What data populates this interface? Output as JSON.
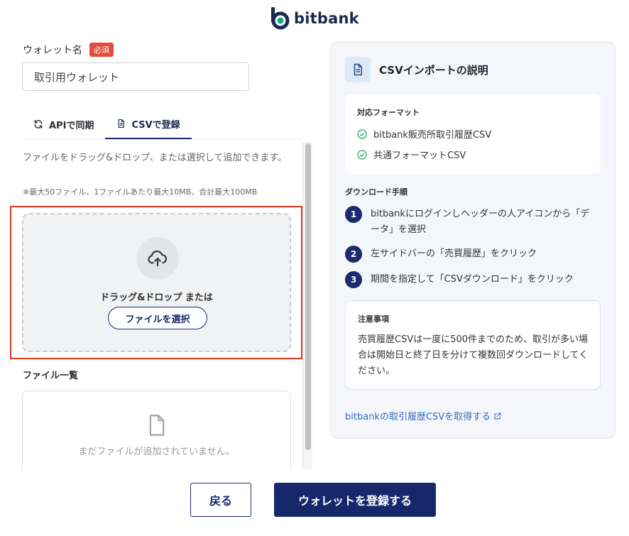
{
  "brand": {
    "name": "bitbank",
    "primary_color": "#1a2a6c",
    "accent_color": "#e14d3f",
    "logo_icon": "bitbank-logo-icon"
  },
  "form": {
    "wallet_name_label": "ウォレット名",
    "required_badge": "必須",
    "wallet_name_value": "取引用ウォレット"
  },
  "tabs": [
    {
      "label": "APIで同期",
      "icon": "sync-icon",
      "active": false
    },
    {
      "label": "CSVで登録",
      "icon": "document-icon",
      "active": true
    }
  ],
  "upload": {
    "description": "ファイルをドラッグ&ドロップ、または選択して追加できます。",
    "note": "※最大50ファイル、1ファイルあたり最大10MB、合計最大100MB",
    "drop_text": "ドラッグ&ドロップ または",
    "choose_label": "ファイルを選択",
    "icon": "upload-cloud-icon"
  },
  "file_list": {
    "title": "ファイル一覧",
    "empty_text": "まだファイルが追加されていません。",
    "icon": "file-icon"
  },
  "panel": {
    "title": "CSVインポートの説明",
    "formats_title": "対応フォーマット",
    "formats": [
      "bitbank販売所取引履歴CSV",
      "共通フォーマットCSV"
    ],
    "steps_title": "ダウンロード手順",
    "steps": [
      {
        "num": "1",
        "text": "bitbankにログインしヘッダーの人アイコンから「データ」を選択"
      },
      {
        "num": "2",
        "text": "左サイドバーの「売買履歴」をクリック"
      },
      {
        "num": "3",
        "text": "期間を指定して「CSVダウンロード」をクリック"
      }
    ],
    "caution_title": "注意事項",
    "caution_text": "売買履歴CSVは一度に500件までのため、取引が多い場合は開始日と終了日を分けて複数回ダウンロードしてください。",
    "link_text": "bitbankの取引履歴CSVを取得する"
  },
  "footer": {
    "back_label": "戻る",
    "register_label": "ウォレットを登録する"
  }
}
